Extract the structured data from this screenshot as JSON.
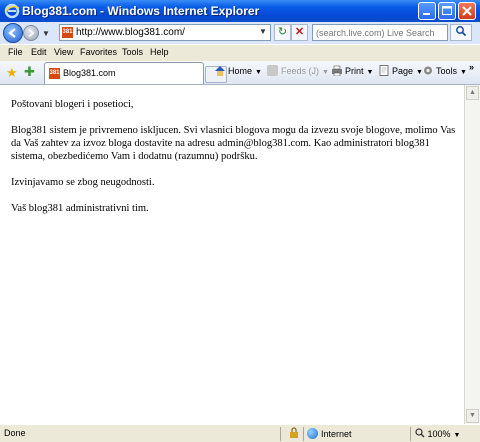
{
  "window": {
    "title": "Blog381.com - Windows Internet Explorer"
  },
  "address_bar": {
    "url": "http://www.blog381.com/",
    "favicon_text": "381"
  },
  "search": {
    "placeholder": "(search.live.com) Live Search"
  },
  "menu": {
    "items": [
      "File",
      "Edit",
      "View",
      "Favorites",
      "Tools",
      "Help"
    ]
  },
  "tab": {
    "label": "Blog381.com",
    "favicon_text": "381"
  },
  "commands": {
    "home": "Home",
    "feeds": "Feeds (J)",
    "print": "Print",
    "page": "Page",
    "tools": "Tools"
  },
  "content": {
    "paragraphs": [
      "Poštovani blogeri i posetioci,",
      "Blog381 sistem je privremeno iskljucen. Svi vlasnici blogova mogu da izvezu svoje blogove, molimo Vas da Vaš zahtev za izvoz bloga dostavite na adresu admin@blog381.com. Kao administratori blog381 sistema, obezbedićemo Vam i dodatnu (razumnu) podršku.",
      "Izvinjavamo se zbog neugodnosti.",
      "Vaš blog381 administrativni tim."
    ]
  },
  "status": {
    "left": "Done",
    "zone": "Internet",
    "zoom": "100%"
  },
  "colors": {
    "titlebar": "#0548d6",
    "chrome": "#ece9d8",
    "favicon": "#d24a10"
  },
  "icons": [
    "ie-icon",
    "back-arrow-icon",
    "forward-arrow-icon",
    "refresh-icon",
    "stop-icon",
    "search-magnifier-icon",
    "favorites-star-icon",
    "add-favorites-icon",
    "home-icon",
    "feeds-icon",
    "print-icon",
    "page-icon",
    "tools-gear-icon",
    "globe-icon",
    "zoom-icon"
  ]
}
